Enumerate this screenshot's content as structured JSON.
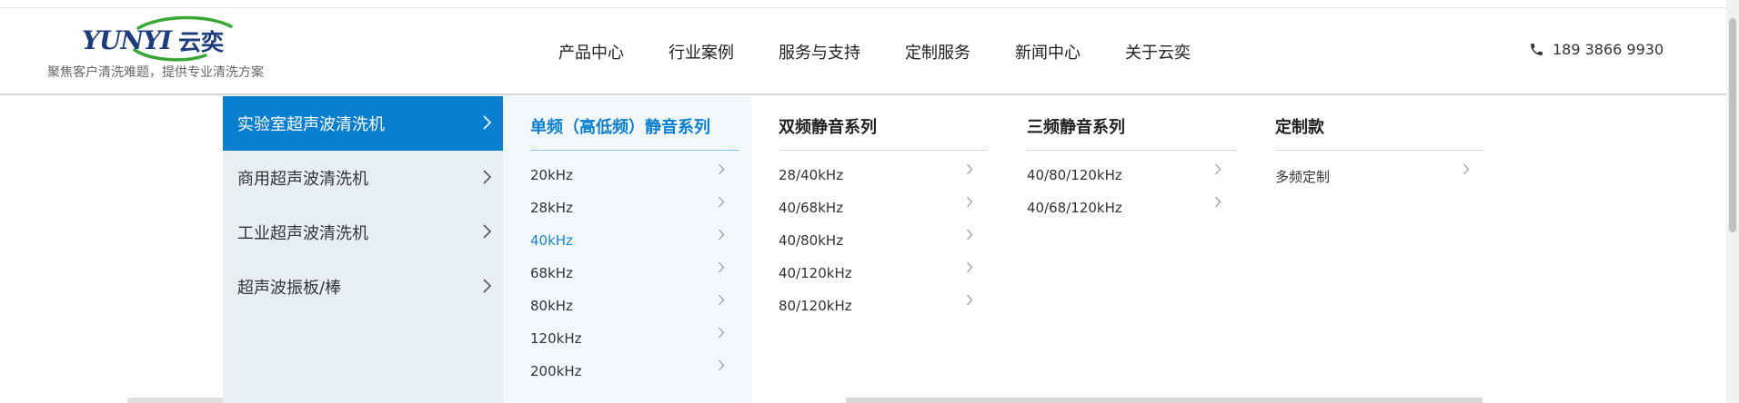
{
  "brand": {
    "logo_text": "YUNYI云奕",
    "slogan": "聚焦客户清洗难题，提供专业清洗方案",
    "colors": {
      "accent": "#0a7fcf",
      "logo_blue": "#1d3c7c",
      "logo_green": "#3aa634"
    }
  },
  "nav": {
    "items": [
      "产品中心",
      "行业案例",
      "服务与支持",
      "定制服务",
      "新闻中心",
      "关于云奕"
    ]
  },
  "phone": {
    "icon": "phone-icon",
    "number": "189 3866 9930"
  },
  "menu": {
    "categories": [
      {
        "label": "实验室超声波清洗机",
        "active": true
      },
      {
        "label": "商用超声波清洗机",
        "active": false
      },
      {
        "label": "工业超声波清洗机",
        "active": false
      },
      {
        "label": "超声波振板/棒",
        "active": false
      }
    ],
    "columns": [
      {
        "title": "单频（高低频）静音系列",
        "items": [
          "20kHz",
          "28kHz",
          "40kHz",
          "68kHz",
          "80kHz",
          "120kHz",
          "200kHz"
        ],
        "active_item": "40kHz"
      },
      {
        "title": "双频静音系列",
        "items": [
          "28/40kHz",
          "40/68kHz",
          "40/80kHz",
          "40/120kHz",
          "80/120kHz"
        ]
      },
      {
        "title": "三频静音系列",
        "items": [
          "40/80/120kHz",
          "40/68/120kHz"
        ]
      },
      {
        "title": "定制款",
        "items": [
          "多频定制"
        ]
      }
    ]
  }
}
